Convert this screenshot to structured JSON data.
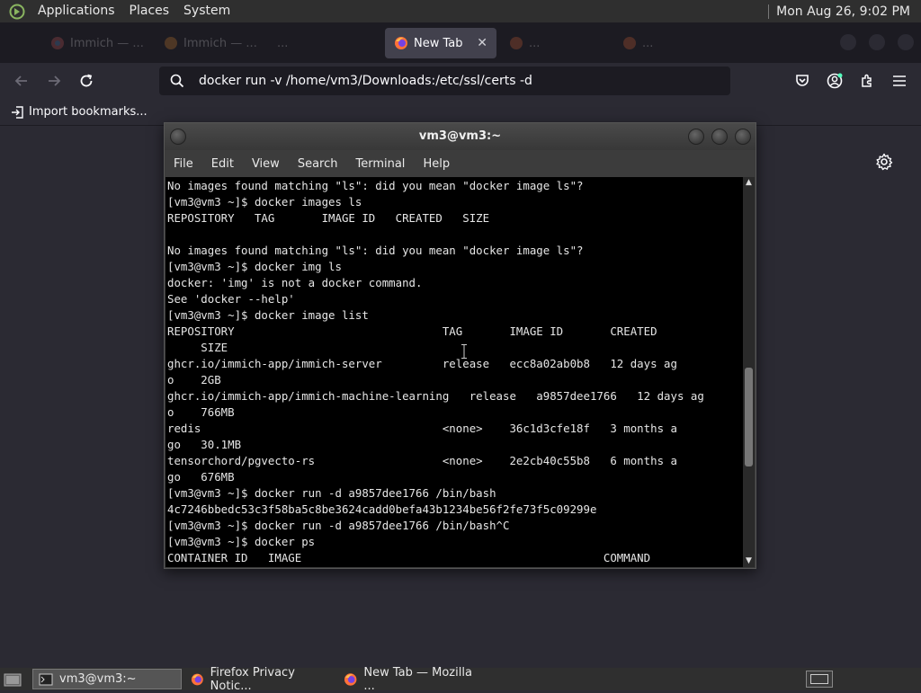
{
  "top_panel": {
    "menus": [
      "Applications",
      "Places",
      "System"
    ],
    "clock": "Mon Aug 26,  9:02 PM"
  },
  "browser": {
    "tabs": [
      {
        "label": "Immich — ...",
        "state": "background"
      },
      {
        "label": "Immich — ...",
        "state": "background"
      },
      {
        "label": "...",
        "state": "background"
      },
      {
        "label": "New Tab",
        "state": "active"
      },
      {
        "label": "...",
        "state": "background"
      },
      {
        "label": "...",
        "state": "background"
      }
    ],
    "url": "docker run -v /home/vm3/Downloads:/etc/ssl/certs -d",
    "bookmarks_import": "Import bookmarks..."
  },
  "terminal": {
    "title": "vm3@vm3:~",
    "menu": [
      "File",
      "Edit",
      "View",
      "Search",
      "Terminal",
      "Help"
    ],
    "lines": [
      "No images found matching \"ls\": did you mean \"docker image ls\"?",
      "[vm3@vm3 ~]$ docker images ls",
      "REPOSITORY   TAG       IMAGE ID   CREATED   SIZE",
      "",
      "No images found matching \"ls\": did you mean \"docker image ls\"?",
      "[vm3@vm3 ~]$ docker img ls",
      "docker: 'img' is not a docker command.",
      "See 'docker --help'",
      "[vm3@vm3 ~]$ docker image list",
      "REPOSITORY                               TAG       IMAGE ID       CREATED",
      "     SIZE",
      "ghcr.io/immich-app/immich-server         release   ecc8a02ab0b8   12 days ag",
      "o    2GB",
      "ghcr.io/immich-app/immich-machine-learning   release   a9857dee1766   12 days ag",
      "o    766MB",
      "redis                                    <none>    36c1d3cfe18f   3 months a",
      "go   30.1MB",
      "tensorchord/pgvecto-rs                   <none>    2e2cb40c55b8   6 months a",
      "go   676MB",
      "[vm3@vm3 ~]$ docker run -d a9857dee1766 /bin/bash",
      "4c7246bbedc53c3f58ba5c8be3624cadd0befa43b1234be56f2fe73f5c09299e",
      "[vm3@vm3 ~]$ docker run -d a9857dee1766 /bin/bash^C",
      "[vm3@vm3 ~]$ docker ps",
      "CONTAINER ID   IMAGE                                             COMMAND"
    ]
  },
  "taskbar": {
    "items": [
      {
        "label": "vm3@vm3:~",
        "state": "active"
      },
      {
        "label": "Firefox Privacy Notic...",
        "state": "normal"
      },
      {
        "label": "New Tab — Mozilla ...",
        "state": "normal"
      }
    ]
  }
}
